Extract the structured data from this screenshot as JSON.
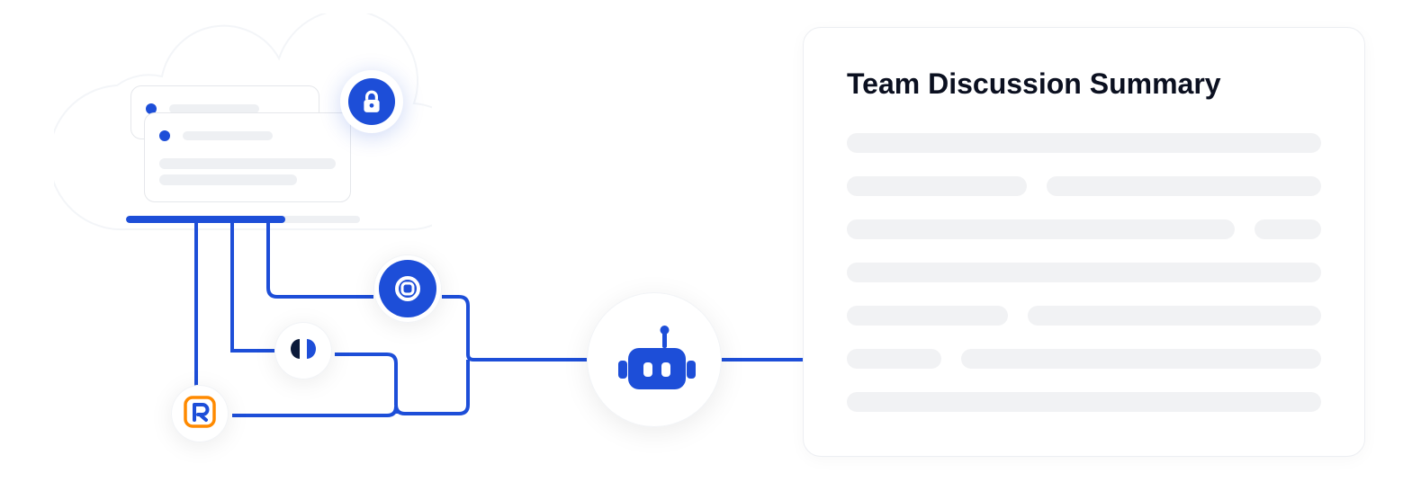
{
  "summary": {
    "title": "Team Discussion Summary"
  },
  "cloud": {
    "progress_percent": 68
  },
  "icons": {
    "lock": "lock-icon",
    "integration_c": "c-logo-icon",
    "integration_oo": "devtools-logo-icon",
    "integration_r": "r-logo-icon",
    "robot": "robot-icon"
  },
  "colors": {
    "accent": "#1d4ed8",
    "r_accent": "#ff8a00",
    "skeleton": "#f1f2f4"
  }
}
